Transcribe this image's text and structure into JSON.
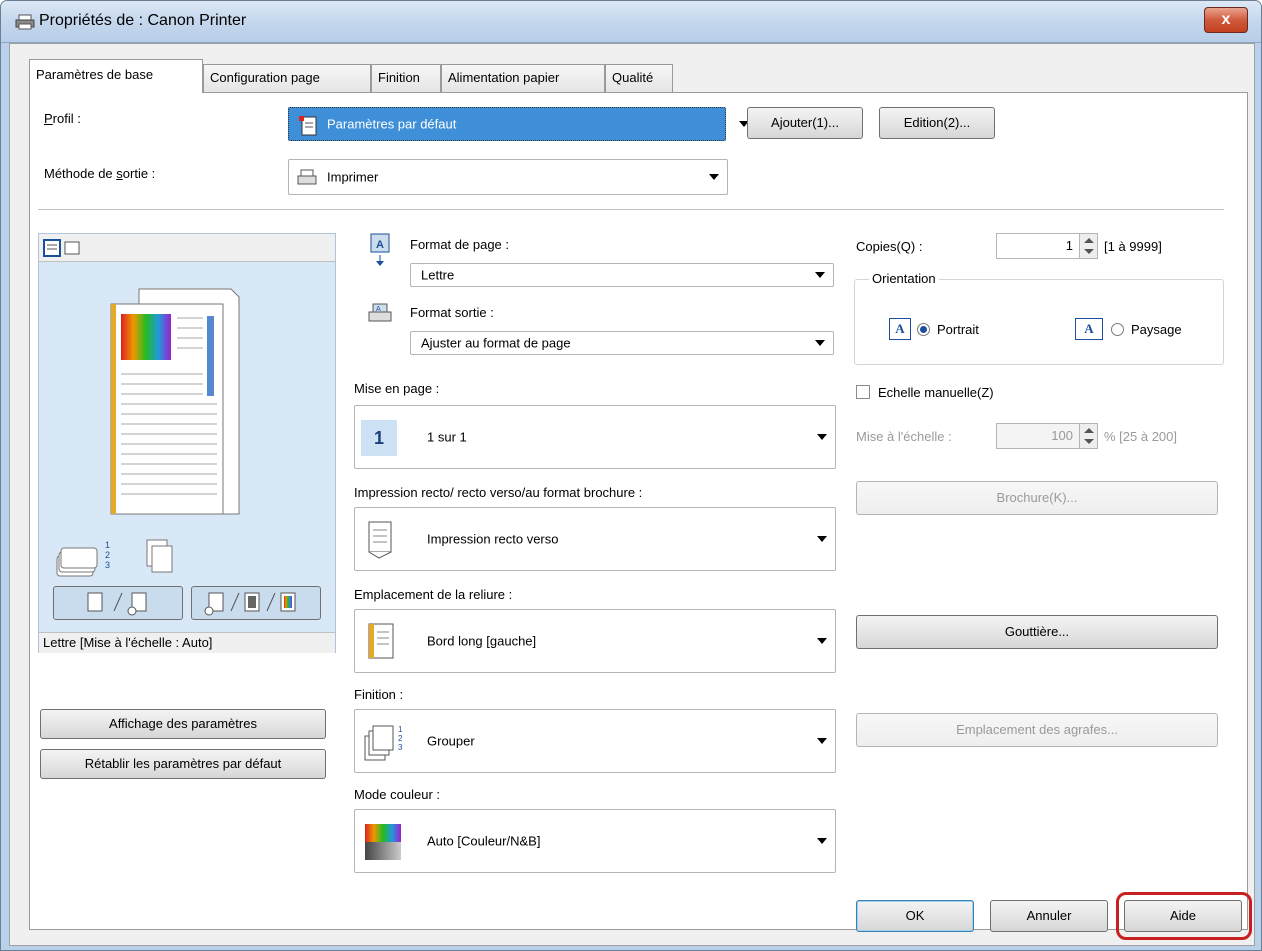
{
  "window": {
    "title": "Propriétés de : Canon Printer",
    "close_label": "x"
  },
  "tabs": [
    {
      "label": "Paramètres de base",
      "active": true
    },
    {
      "label": "Configuration page",
      "active": false
    },
    {
      "label": "Finition",
      "active": false
    },
    {
      "label": "Alimentation papier",
      "active": false
    },
    {
      "label": "Qualité",
      "active": false
    }
  ],
  "profile": {
    "label_access": "P",
    "label_rest": "rofil :",
    "value": "Paramètres par défaut",
    "add_button": "Ajouter(1)...",
    "edit_button": "Edition(2)..."
  },
  "output_method": {
    "label_pre": "Méthode de ",
    "label_access": "s",
    "label_post": "ortie :",
    "value": "Imprimer"
  },
  "preview": {
    "status": "Lettre [Mise à l'échelle : Auto]"
  },
  "left_buttons": {
    "settings_view": "Affichage des paramètres",
    "restore_defaults": "Rétablir les paramètres par défaut"
  },
  "page_size": {
    "label": "Format de page :",
    "value": "Lettre"
  },
  "output_size": {
    "label": "Format sortie :",
    "value": "Ajuster au format de page"
  },
  "layout": {
    "label": "Mise en page :",
    "value": "1 sur 1",
    "icon_number": "1"
  },
  "print_style": {
    "label": "Impression recto/ recto verso/au format brochure :",
    "value": "Impression recto verso"
  },
  "binding": {
    "label": "Emplacement de la reliure :",
    "value": "Bord long [gauche]"
  },
  "finishing": {
    "label": "Finition :",
    "value": "Grouper"
  },
  "color_mode": {
    "label": "Mode couleur :",
    "value": "Auto [Couleur/N&B]"
  },
  "copies": {
    "label": "Copies(Q) :",
    "value": "1",
    "range": "[1 à 9999]"
  },
  "orientation": {
    "label": "Orientation",
    "portrait": "Portrait",
    "landscape": "Paysage",
    "selected": "Portrait"
  },
  "manual_scale": {
    "label": "Echelle manuelle(Z)",
    "checked": false
  },
  "scaling": {
    "label": "Mise à l'échelle :",
    "value": "100",
    "range": "% [25 à 200]"
  },
  "right_buttons": {
    "booklet": "Brochure(K)...",
    "gutter": "Gouttière...",
    "staple": "Emplacement des agrafes..."
  },
  "bottom_buttons": {
    "ok": "OK",
    "cancel": "Annuler",
    "help": "Aide"
  },
  "colors": {
    "accent": "#1a4f9c",
    "highlight_ring": "#c8201e",
    "selection": "#3f8fd8"
  }
}
